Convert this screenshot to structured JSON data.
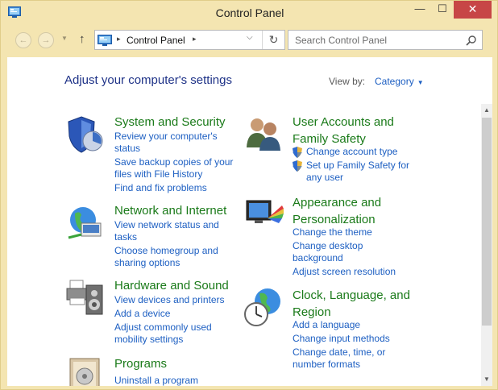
{
  "window": {
    "title": "Control Panel",
    "minimize_glyph": "—",
    "maximize_glyph": "☐",
    "close_glyph": "✕",
    "icon": "control-panel-icon",
    "accent_color": "#c74646"
  },
  "nav": {
    "back_glyph": "←",
    "forward_glyph": "→",
    "recent_glyph": "▼",
    "up_glyph": "↑",
    "address": "Control Panel",
    "separator_glyph": "▸",
    "dropdown_glyph": "⌵",
    "refresh_glyph": "↻",
    "search_placeholder": "Search Control Panel"
  },
  "main": {
    "heading": "Adjust your computer's settings",
    "view_by_label": "View by:",
    "view_by_value": "Category",
    "view_caret": "▼"
  },
  "categories": [
    {
      "title": "System and Security",
      "icon": "security-shield-icon",
      "links": [
        "Review your computer's status",
        "Save backup copies of your files with File History",
        "Find and fix problems"
      ]
    },
    {
      "title": "User Accounts and Family Safety",
      "icon": "user-accounts-icon",
      "links": [
        "Change account type",
        "Set up Family Safety for any user"
      ]
    },
    {
      "title": "Network and Internet",
      "icon": "network-globe-icon",
      "links": [
        "View network status and tasks",
        "Choose homegroup and sharing options"
      ]
    },
    {
      "title": "Appearance and Personalization",
      "icon": "appearance-monitor-icon",
      "links": [
        "Change the theme",
        "Change desktop background",
        "Adjust screen resolution"
      ]
    },
    {
      "title": "Hardware and Sound",
      "icon": "printer-speaker-icon",
      "links": [
        "View devices and printers",
        "Add a device",
        "Adjust commonly used mobility settings"
      ]
    },
    {
      "title": "Clock, Language, and Region",
      "icon": "clock-globe-icon",
      "links": [
        "Add a language",
        "Change input methods",
        "Change date, time, or number formats"
      ]
    },
    {
      "title": "Programs",
      "icon": "programs-icon",
      "links": [
        "Uninstall a program"
      ]
    }
  ],
  "scrollbar": {
    "up_glyph": "▲",
    "down_glyph": "▼"
  }
}
